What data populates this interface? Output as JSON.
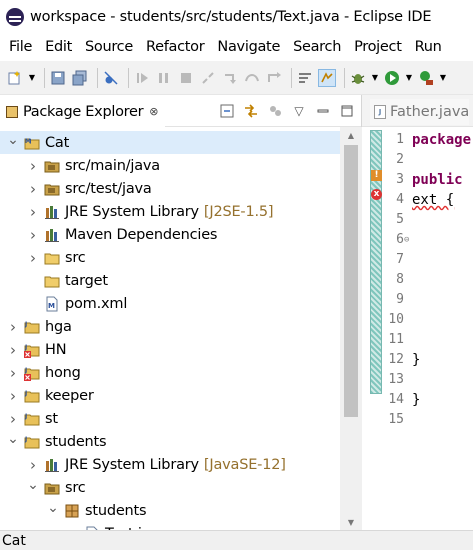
{
  "window": {
    "title": "workspace - students/src/students/Text.java - Eclipse IDE"
  },
  "menu": [
    "File",
    "Edit",
    "Source",
    "Refactor",
    "Navigate",
    "Search",
    "Project",
    "Run"
  ],
  "explorer": {
    "title": "Package Explorer",
    "close_glyph": "⊗",
    "tree": [
      {
        "label": "Cat",
        "decoration": "",
        "icon": "maven-project-icon",
        "twisty": "expanded",
        "indent": 0,
        "selected": true
      },
      {
        "label": "src/main/java",
        "decoration": "",
        "icon": "source-folder-icon",
        "twisty": "collapsed",
        "indent": 1,
        "selected": false
      },
      {
        "label": "src/test/java",
        "decoration": "",
        "icon": "source-folder-icon",
        "twisty": "collapsed",
        "indent": 1,
        "selected": false
      },
      {
        "label": "JRE System Library",
        "decoration": "[J2SE-1.5]",
        "icon": "library-icon",
        "twisty": "collapsed",
        "indent": 1,
        "selected": false
      },
      {
        "label": "Maven Dependencies",
        "decoration": "",
        "icon": "library-icon",
        "twisty": "collapsed",
        "indent": 1,
        "selected": false
      },
      {
        "label": "src",
        "decoration": "",
        "icon": "folder-icon",
        "twisty": "collapsed",
        "indent": 1,
        "selected": false
      },
      {
        "label": "target",
        "decoration": "",
        "icon": "folder-icon",
        "twisty": "none",
        "indent": 1,
        "selected": false
      },
      {
        "label": "pom.xml",
        "decoration": "",
        "icon": "pom-file-icon",
        "twisty": "none",
        "indent": 1,
        "selected": false
      },
      {
        "label": "hga",
        "decoration": "",
        "icon": "java-project-icon",
        "twisty": "collapsed",
        "indent": 0,
        "selected": false
      },
      {
        "label": "HN",
        "decoration": "",
        "icon": "java-project-error-icon",
        "twisty": "collapsed",
        "indent": 0,
        "selected": false
      },
      {
        "label": "hong",
        "decoration": "",
        "icon": "java-project-error-icon",
        "twisty": "collapsed",
        "indent": 0,
        "selected": false
      },
      {
        "label": "keeper",
        "decoration": "",
        "icon": "java-project-icon",
        "twisty": "collapsed",
        "indent": 0,
        "selected": false
      },
      {
        "label": "st",
        "decoration": "",
        "icon": "java-project-icon",
        "twisty": "collapsed",
        "indent": 0,
        "selected": false
      },
      {
        "label": "students",
        "decoration": "",
        "icon": "java-project-icon",
        "twisty": "expanded",
        "indent": 0,
        "selected": false
      },
      {
        "label": "JRE System Library",
        "decoration": "[JavaSE-12]",
        "icon": "library-icon",
        "twisty": "collapsed",
        "indent": 1,
        "selected": false
      },
      {
        "label": "src",
        "decoration": "",
        "icon": "source-folder-icon",
        "twisty": "expanded",
        "indent": 1,
        "selected": false
      },
      {
        "label": "students",
        "decoration": "",
        "icon": "package-icon",
        "twisty": "expanded",
        "indent": 2,
        "selected": false
      },
      {
        "label": "Text.java",
        "decoration": "",
        "icon": "java-file-icon",
        "twisty": "none",
        "indent": 3,
        "selected": false
      }
    ]
  },
  "editor": {
    "tab_label": "Father.java",
    "line_numbers": [
      "1",
      "2",
      "3",
      "4",
      "5",
      "6",
      "7",
      "8",
      "9",
      "10",
      "11",
      "12",
      "13",
      "14",
      "15"
    ],
    "code_fragments": {
      "line1": "package",
      "line3": "public",
      "line4": "ext {",
      "line12": "}",
      "line14": "}"
    }
  },
  "status": {
    "text": "Cat"
  },
  "colors": {
    "selection": "#dcecfb",
    "keyword": "#7f0055",
    "decoration": "#95712e",
    "error": "#d33333"
  }
}
